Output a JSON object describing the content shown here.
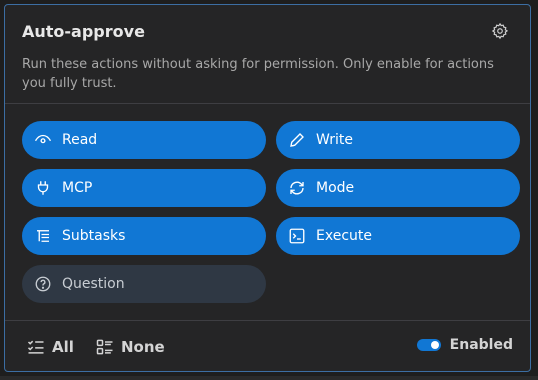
{
  "panel": {
    "title": "Auto-approve",
    "settings_icon": "gear-icon",
    "description": "Run these actions without asking for permission. Only enable for actions you fully trust."
  },
  "actions": [
    {
      "label": "Read",
      "icon": "eye-icon",
      "enabled": true
    },
    {
      "label": "Write",
      "icon": "pencil-icon",
      "enabled": true
    },
    {
      "label": "MCP",
      "icon": "plug-icon",
      "enabled": true
    },
    {
      "label": "Mode",
      "icon": "sync-icon",
      "enabled": true
    },
    {
      "label": "Subtasks",
      "icon": "list-tree-icon",
      "enabled": true
    },
    {
      "label": "Execute",
      "icon": "terminal-icon",
      "enabled": true
    },
    {
      "label": "Question",
      "icon": "question-icon",
      "enabled": false
    }
  ],
  "footer": {
    "all_label": "All",
    "none_label": "None",
    "toggle_label": "Enabled",
    "toggle_on": true
  },
  "colors": {
    "accent": "#1177d4",
    "panel_bg": "#252526",
    "inactive_bg": "#2f3844"
  }
}
